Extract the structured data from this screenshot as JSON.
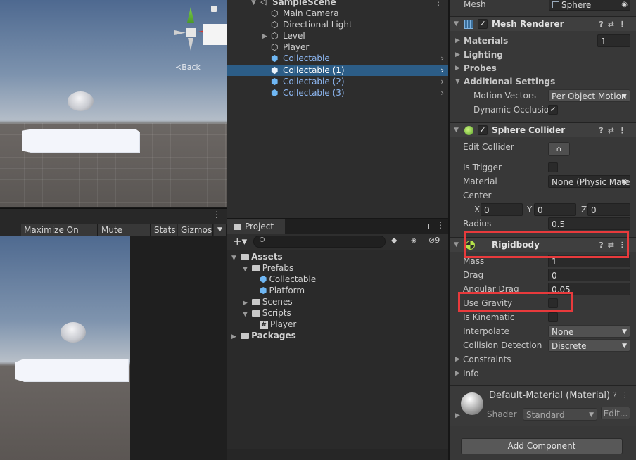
{
  "scene": {
    "back_label": "Back"
  },
  "game_toolbar": {
    "maximize": "Maximize On Play",
    "mute": "Mute Audio",
    "stats": "Stats",
    "gizmos": "Gizmos"
  },
  "hierarchy": {
    "scene_name": "SampleScene",
    "items": [
      {
        "label": "Main Camera"
      },
      {
        "label": "Directional Light"
      },
      {
        "label": "Level"
      },
      {
        "label": "Player"
      },
      {
        "label": "Collectable"
      },
      {
        "label": "Collectable (1)"
      },
      {
        "label": "Collectable (2)"
      },
      {
        "label": "Collectable (3)"
      }
    ]
  },
  "project": {
    "tab": "Project",
    "hidden_count": "9",
    "tree": {
      "assets": "Assets",
      "prefabs": "Prefabs",
      "collectable": "Collectable",
      "platform": "Platform",
      "scenes": "Scenes",
      "scripts": "Scripts",
      "player": "Player",
      "packages": "Packages"
    }
  },
  "inspector": {
    "mesh_label": "Mesh",
    "mesh_value": "Sphere",
    "mesh_renderer": {
      "title": "Mesh Renderer",
      "materials": "Materials",
      "materials_count": "1",
      "lighting": "Lighting",
      "probes": "Probes",
      "additional": "Additional Settings",
      "motion_vectors": "Motion Vectors",
      "motion_vectors_value": "Per Object Motion",
      "dynamic_occlusion": "Dynamic Occlusion"
    },
    "sphere_collider": {
      "title": "Sphere Collider",
      "edit_collider": "Edit Collider",
      "is_trigger": "Is Trigger",
      "material": "Material",
      "material_value": "None (Physic Material)",
      "center": "Center",
      "x_label": "X",
      "y_label": "Y",
      "z_label": "Z",
      "x": "0",
      "y": "0",
      "z": "0",
      "radius": "Radius",
      "radius_value": "0.5"
    },
    "rigidbody": {
      "title": "Rigidbody",
      "mass": "Mass",
      "mass_value": "1",
      "drag": "Drag",
      "drag_value": "0",
      "angular_drag": "Angular Drag",
      "angular_drag_value": "0.05",
      "use_gravity": "Use Gravity",
      "is_kinematic": "Is Kinematic",
      "interpolate": "Interpolate",
      "interpolate_value": "None",
      "collision_detection": "Collision Detection",
      "collision_detection_value": "Discrete",
      "constraints": "Constraints",
      "info": "Info"
    },
    "material": {
      "title": "Default-Material (Material)",
      "shader_label": "Shader",
      "shader_value": "Standard",
      "edit": "Edit..."
    },
    "add_component": "Add Component"
  },
  "colors": {
    "selection": "#2c5d87",
    "prefab_text": "#8db7f1",
    "highlight": "#e83a3c"
  }
}
